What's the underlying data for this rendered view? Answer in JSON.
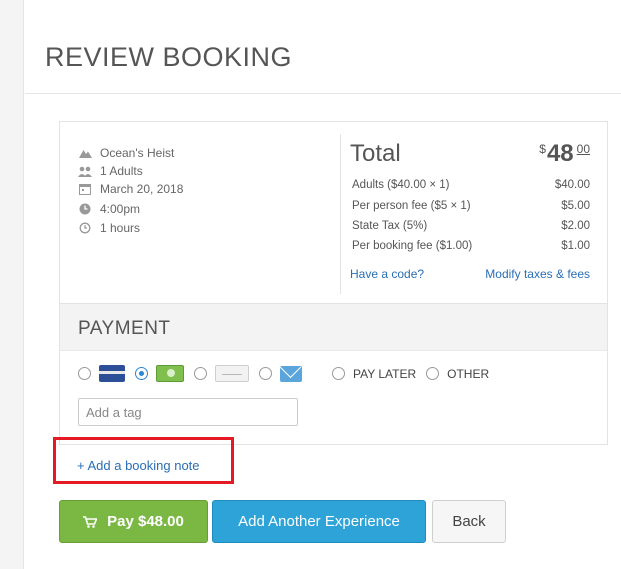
{
  "page": {
    "title": "REVIEW BOOKING"
  },
  "summary": {
    "experience": "Ocean's Heist",
    "guests": "1 Adults",
    "date": "March 20, 2018",
    "time": "4:00pm",
    "duration": "1 hours"
  },
  "totals": {
    "label": "Total",
    "currency": "$",
    "amount_whole": "48",
    "amount_cents": "00",
    "items": [
      {
        "label": "Adults ($40.00 × 1)",
        "value": "$40.00"
      },
      {
        "label": "Per person fee ($5 × 1)",
        "value": "$5.00"
      },
      {
        "label": "State Tax (5%)",
        "value": "$2.00"
      },
      {
        "label": "Per booking fee ($1.00)",
        "value": "$1.00"
      }
    ],
    "code_link": "Have a code?",
    "modify_link": "Modify taxes & fees"
  },
  "payment": {
    "title": "PAYMENT",
    "methods": [
      {
        "icon": "credit-card-icon",
        "selected": false
      },
      {
        "icon": "cash-icon",
        "selected": true
      },
      {
        "icon": "check-icon",
        "selected": false
      },
      {
        "icon": "mail-invoice-icon",
        "selected": false
      }
    ],
    "pay_later_label": "PAY LATER",
    "other_label": "OTHER",
    "tag_placeholder": "Add a tag"
  },
  "note_link": "+ Add a booking note",
  "buttons": {
    "pay": "Pay $48.00",
    "add_experience": "Add Another Experience",
    "back": "Back"
  },
  "colors": {
    "pay_button": "#7ab743",
    "add_button": "#2ea3d8",
    "link": "#2a6eb5",
    "highlight_box": "#e41b23"
  }
}
